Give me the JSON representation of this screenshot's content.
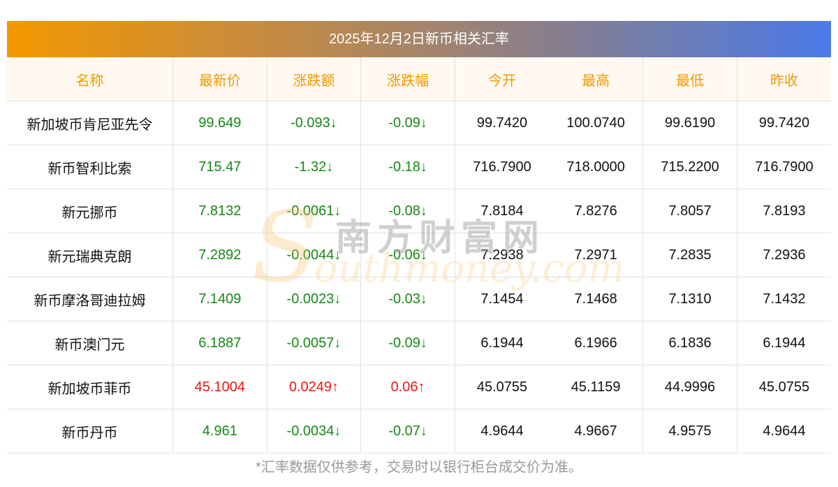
{
  "title": "2025年12月2日新币相关汇率",
  "headers": [
    "名称",
    "最新价",
    "涨跌额",
    "涨跌幅",
    "今开",
    "最高",
    "最低",
    "昨收"
  ],
  "rows": [
    {
      "name": "新加坡币肯尼亚先令",
      "price": "99.649",
      "change": "-0.093↓",
      "pct": "-0.09↓",
      "open": "99.7420",
      "high": "100.0740",
      "low": "99.6190",
      "prev": "99.7420",
      "dir": "down"
    },
    {
      "name": "新币智利比索",
      "price": "715.47",
      "change": "-1.32↓",
      "pct": "-0.18↓",
      "open": "716.7900",
      "high": "718.0000",
      "low": "715.2200",
      "prev": "716.7900",
      "dir": "down"
    },
    {
      "name": "新元挪币",
      "price": "7.8132",
      "change": "-0.0061↓",
      "pct": "-0.08↓",
      "open": "7.8184",
      "high": "7.8276",
      "low": "7.8057",
      "prev": "7.8193",
      "dir": "down"
    },
    {
      "name": "新元瑞典克朗",
      "price": "7.2892",
      "change": "-0.0044↓",
      "pct": "-0.06↓",
      "open": "7.2938",
      "high": "7.2971",
      "low": "7.2835",
      "prev": "7.2936",
      "dir": "down"
    },
    {
      "name": "新币摩洛哥迪拉姆",
      "price": "7.1409",
      "change": "-0.0023↓",
      "pct": "-0.03↓",
      "open": "7.1454",
      "high": "7.1468",
      "low": "7.1310",
      "prev": "7.1432",
      "dir": "down"
    },
    {
      "name": "新币澳门元",
      "price": "6.1887",
      "change": "-0.0057↓",
      "pct": "-0.09↓",
      "open": "6.1944",
      "high": "6.1966",
      "low": "6.1836",
      "prev": "6.1944",
      "dir": "down"
    },
    {
      "name": "新加坡币菲币",
      "price": "45.1004",
      "change": "0.0249↑",
      "pct": "0.06↑",
      "open": "45.0755",
      "high": "45.1159",
      "low": "44.9996",
      "prev": "45.0755",
      "dir": "up"
    },
    {
      "name": "新币丹币",
      "price": "4.961",
      "change": "-0.0034↓",
      "pct": "-0.07↓",
      "open": "4.9644",
      "high": "4.9667",
      "low": "4.9575",
      "prev": "4.9644",
      "dir": "down"
    }
  ],
  "watermark": {
    "cn": "南方财富网",
    "en": "outhmoney.com",
    "s": "S"
  },
  "footer": "*汇率数据仅供参考，交易时以银行柜台成交价为准。"
}
